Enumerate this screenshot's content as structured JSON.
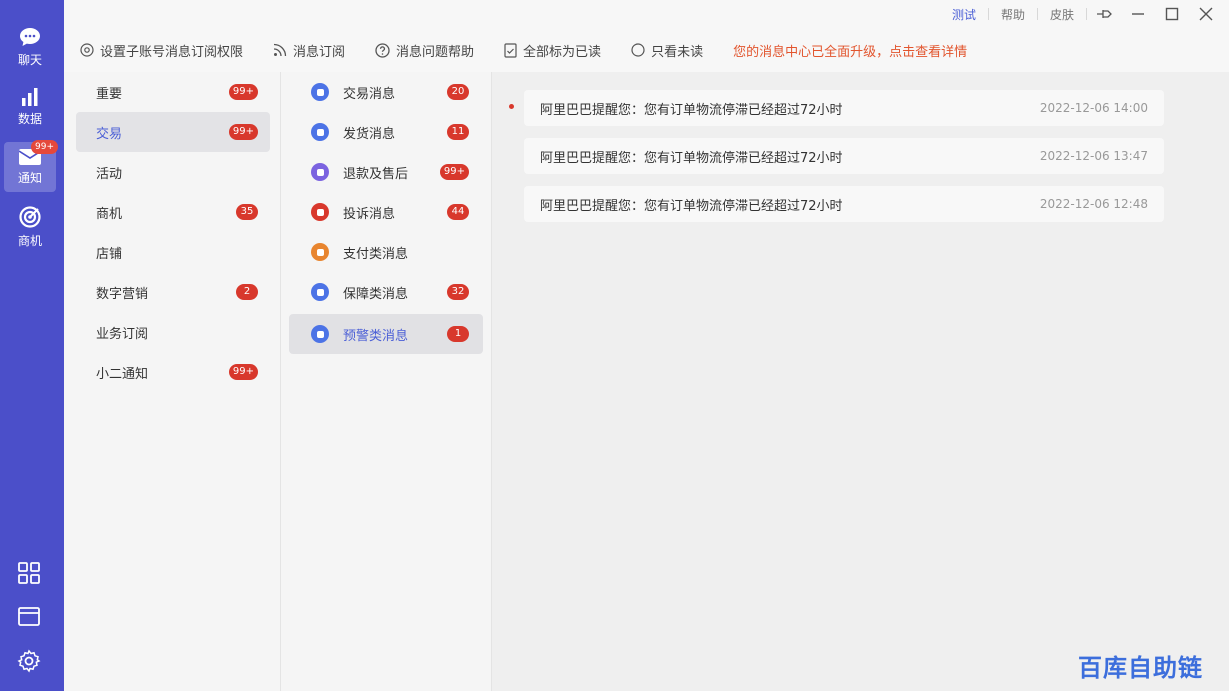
{
  "rail": {
    "items": [
      {
        "label": "聊天",
        "icon": "chat-bubble-icon"
      },
      {
        "label": "数据",
        "icon": "bar-chart-icon"
      },
      {
        "label": "通知",
        "icon": "envelope-icon",
        "badge": "99+"
      },
      {
        "label": "商机",
        "icon": "target-icon"
      }
    ],
    "bottom_icons": [
      "grid-icon",
      "window-icon",
      "settings-icon"
    ]
  },
  "titlebar": {
    "links": [
      "测试",
      "帮助",
      "皮肤"
    ],
    "controls": [
      "pin-icon",
      "minimize-icon",
      "maximize-icon",
      "close-icon"
    ]
  },
  "toolbar": {
    "items": [
      {
        "label": "设置子账号消息订阅权限",
        "icon": "settings-circle-icon"
      },
      {
        "label": "消息订阅",
        "icon": "rss-icon"
      },
      {
        "label": "消息问题帮助",
        "icon": "help-icon"
      },
      {
        "label": "全部标为已读",
        "icon": "doc-check-icon"
      },
      {
        "label": "只看未读",
        "icon": "radio-icon"
      }
    ],
    "notice": "您的消息中心已全面升级，点击查看详情"
  },
  "categories": [
    {
      "label": "重要",
      "badge": "99+"
    },
    {
      "label": "交易",
      "badge": "99+",
      "active": true
    },
    {
      "label": "活动",
      "badge": ""
    },
    {
      "label": "商机",
      "badge": "35"
    },
    {
      "label": "店铺",
      "badge": ""
    },
    {
      "label": "数字营销",
      "badge": "2"
    },
    {
      "label": "业务订阅",
      "badge": ""
    },
    {
      "label": "小二通知",
      "badge": "99+"
    }
  ],
  "subcategories": [
    {
      "label": "交易消息",
      "badge": "20",
      "color": "#4c73e6"
    },
    {
      "label": "发货消息",
      "badge": "11",
      "color": "#4c73e6"
    },
    {
      "label": "退款及售后",
      "badge": "99+",
      "color": "#7b63e0"
    },
    {
      "label": "投诉消息",
      "badge": "44",
      "color": "#d8382c"
    },
    {
      "label": "支付类消息",
      "badge": "",
      "color": "#e8852f"
    },
    {
      "label": "保障类消息",
      "badge": "32",
      "color": "#4c73e6"
    },
    {
      "label": "预警类消息",
      "badge": "1",
      "color": "#4c73e6",
      "active": true
    }
  ],
  "messages": [
    {
      "text": "阿里巴巴提醒您：您有订单物流停滞已经超过72小时",
      "time": "2022-12-06 14:00",
      "unread": true
    },
    {
      "text": "阿里巴巴提醒您：您有订单物流停滞已经超过72小时",
      "time": "2022-12-06 13:47",
      "unread": false
    },
    {
      "text": "阿里巴巴提醒您：您有订单物流停滞已经超过72小时",
      "time": "2022-12-06 12:48",
      "unread": false
    }
  ],
  "watermark": "百库自助链",
  "colors": {
    "rail": "#4b4fc9",
    "accent": "#4b5fd6",
    "badge": "#d8382c",
    "notice": "#e2552e"
  }
}
